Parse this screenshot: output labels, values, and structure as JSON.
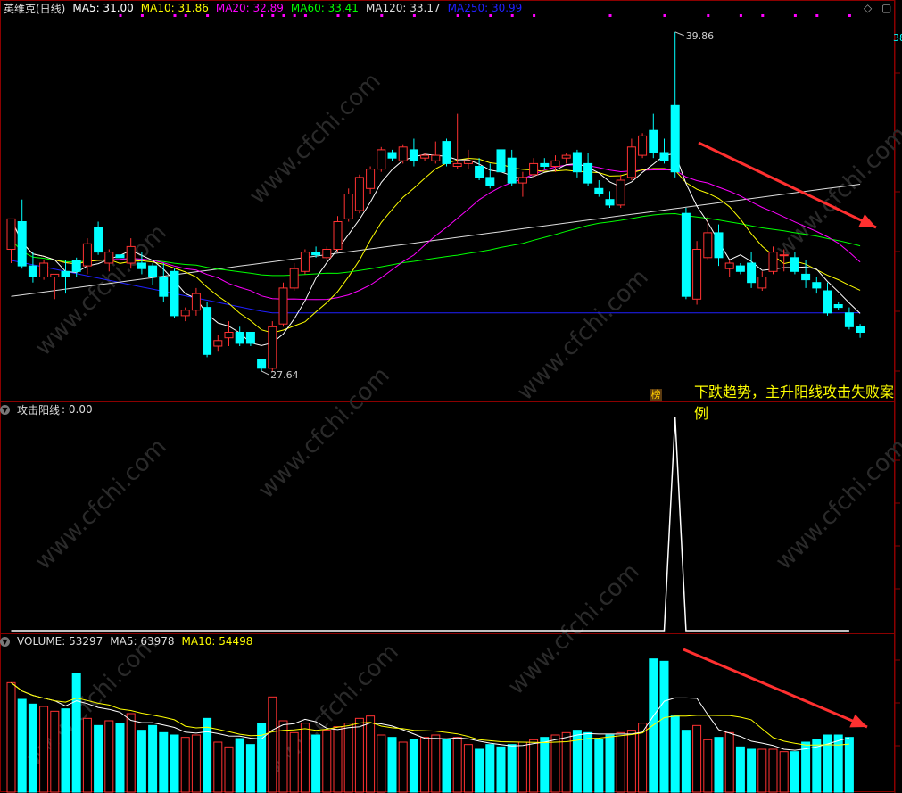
{
  "main": {
    "title": "英维克(日线)",
    "ma": [
      {
        "label": "MA5: 31.00",
        "color": "#ffffff"
      },
      {
        "label": "MA10: 31.86",
        "color": "#ffff00"
      },
      {
        "label": "MA20: 32.89",
        "color": "#ff00ff"
      },
      {
        "label": "MA60: 33.41",
        "color": "#00ff00"
      },
      {
        "label": "MA120: 33.17",
        "color": "#dddddd"
      },
      {
        "label": "MA250: 30.99",
        "color": "#2020ff"
      }
    ],
    "high_label": "39.86",
    "low_label": "27.64",
    "right_edge_label": "38",
    "badge": "榜"
  },
  "annotation": "下跌趋势，主升阳线攻击失败案例",
  "indicator": {
    "title": "攻击阳线",
    "value": ": 0.00"
  },
  "volume": {
    "label": "VOLUME: 53297",
    "ma5": "MA5: 63978",
    "ma10": "MA10: 54498"
  },
  "watermark": "www.cfchi.com",
  "colors": {
    "up": "#ff3232",
    "down": "#00ffff",
    "grid": "#8b0000",
    "ma5": "#ffffff",
    "ma10": "#ffff00",
    "ma20": "#ff00ff",
    "ma60": "#00ff00",
    "ma120": "#dddddd",
    "ma250": "#2020ff"
  },
  "chart_data": {
    "type": "candlestick",
    "candles": [
      {
        "o": 32.0,
        "h": 33.1,
        "c": 33.1,
        "l": 31.5
      },
      {
        "o": 33.0,
        "h": 33.8,
        "c": 31.4,
        "l": 31.3
      },
      {
        "o": 31.4,
        "h": 31.9,
        "c": 31.0,
        "l": 30.8
      },
      {
        "o": 31.0,
        "h": 31.6,
        "c": 31.5,
        "l": 30.9
      },
      {
        "o": 31.0,
        "h": 31.1,
        "c": 31.1,
        "l": 30.2
      },
      {
        "o": 31.2,
        "h": 31.6,
        "c": 31.0,
        "l": 30.4
      },
      {
        "o": 31.6,
        "h": 31.7,
        "c": 31.2,
        "l": 31.0
      },
      {
        "o": 31.4,
        "h": 32.4,
        "c": 32.2,
        "l": 31.1
      },
      {
        "o": 32.8,
        "h": 33.0,
        "c": 31.9,
        "l": 31.8
      },
      {
        "o": 31.5,
        "h": 32.0,
        "c": 31.9,
        "l": 31.2
      },
      {
        "o": 31.8,
        "h": 32.0,
        "c": 31.7,
        "l": 31.4
      },
      {
        "o": 31.5,
        "h": 32.4,
        "c": 32.1,
        "l": 31.3
      },
      {
        "o": 31.5,
        "h": 31.9,
        "c": 31.3,
        "l": 31.1
      },
      {
        "o": 31.4,
        "h": 31.5,
        "c": 31.0,
        "l": 30.7
      },
      {
        "o": 31.0,
        "h": 31.5,
        "c": 30.3,
        "l": 30.1
      },
      {
        "o": 31.2,
        "h": 31.3,
        "c": 29.6,
        "l": 29.5
      },
      {
        "o": 29.6,
        "h": 29.9,
        "c": 29.8,
        "l": 29.4
      },
      {
        "o": 29.8,
        "h": 30.6,
        "c": 30.4,
        "l": 29.6
      },
      {
        "o": 29.9,
        "h": 30.1,
        "c": 28.2,
        "l": 28.1
      },
      {
        "o": 28.5,
        "h": 28.9,
        "c": 28.7,
        "l": 28.3
      },
      {
        "o": 28.8,
        "h": 29.4,
        "c": 29.0,
        "l": 28.5
      },
      {
        "o": 29.0,
        "h": 29.2,
        "c": 28.6,
        "l": 28.5
      },
      {
        "o": 29.0,
        "h": 29.0,
        "c": 28.6,
        "l": 28.5
      },
      {
        "o": 28.0,
        "h": 28.0,
        "c": 27.7,
        "l": 27.6
      },
      {
        "o": 27.7,
        "h": 29.4,
        "c": 29.2,
        "l": 27.6
      },
      {
        "o": 29.3,
        "h": 30.8,
        "c": 30.6,
        "l": 29.2
      },
      {
        "o": 30.6,
        "h": 31.5,
        "c": 31.3,
        "l": 30.5
      },
      {
        "o": 31.2,
        "h": 32.0,
        "c": 31.9,
        "l": 31.1
      },
      {
        "o": 31.9,
        "h": 32.1,
        "c": 31.8,
        "l": 31.7
      },
      {
        "o": 31.7,
        "h": 32.1,
        "c": 32.0,
        "l": 31.6
      },
      {
        "o": 32.0,
        "h": 33.2,
        "c": 33.0,
        "l": 31.9
      },
      {
        "o": 33.1,
        "h": 34.2,
        "c": 34.0,
        "l": 33.0
      },
      {
        "o": 33.4,
        "h": 34.7,
        "c": 34.6,
        "l": 33.3
      },
      {
        "o": 34.2,
        "h": 35.0,
        "c": 34.9,
        "l": 34.0
      },
      {
        "o": 34.9,
        "h": 35.7,
        "c": 35.6,
        "l": 34.8
      },
      {
        "o": 35.5,
        "h": 35.6,
        "c": 35.3,
        "l": 35.2
      },
      {
        "o": 35.2,
        "h": 35.8,
        "c": 35.7,
        "l": 35.1
      },
      {
        "o": 35.6,
        "h": 36.0,
        "c": 35.2,
        "l": 35.0
      },
      {
        "o": 35.3,
        "h": 35.5,
        "c": 35.4,
        "l": 35.2
      },
      {
        "o": 35.2,
        "h": 35.9,
        "c": 35.4,
        "l": 35.1
      },
      {
        "o": 35.9,
        "h": 36.0,
        "c": 35.1,
        "l": 35.0
      },
      {
        "o": 35.0,
        "h": 36.9,
        "c": 35.1,
        "l": 34.9
      },
      {
        "o": 35.1,
        "h": 35.6,
        "c": 35.2,
        "l": 34.9
      },
      {
        "o": 35.0,
        "h": 35.3,
        "c": 34.6,
        "l": 34.5
      },
      {
        "o": 34.6,
        "h": 35.1,
        "c": 34.3,
        "l": 34.2
      },
      {
        "o": 35.6,
        "h": 35.8,
        "c": 34.8,
        "l": 34.6
      },
      {
        "o": 35.3,
        "h": 35.6,
        "c": 34.4,
        "l": 34.3
      },
      {
        "o": 34.4,
        "h": 34.8,
        "c": 34.6,
        "l": 33.9
      },
      {
        "o": 34.7,
        "h": 35.3,
        "c": 35.1,
        "l": 34.6
      },
      {
        "o": 35.1,
        "h": 35.3,
        "c": 35.0,
        "l": 34.9
      },
      {
        "o": 35.0,
        "h": 35.4,
        "c": 35.2,
        "l": 34.8
      },
      {
        "o": 35.3,
        "h": 35.5,
        "c": 35.4,
        "l": 35.1
      },
      {
        "o": 35.5,
        "h": 35.6,
        "c": 34.8,
        "l": 34.6
      },
      {
        "o": 35.1,
        "h": 35.5,
        "c": 34.4,
        "l": 34.3
      },
      {
        "o": 34.2,
        "h": 34.5,
        "c": 34.0,
        "l": 33.9
      },
      {
        "o": 33.8,
        "h": 34.1,
        "c": 33.6,
        "l": 33.5
      },
      {
        "o": 33.6,
        "h": 34.7,
        "c": 34.5,
        "l": 33.5
      },
      {
        "o": 34.6,
        "h": 36.0,
        "c": 35.7,
        "l": 34.5
      },
      {
        "o": 35.4,
        "h": 36.2,
        "c": 36.1,
        "l": 35.3
      },
      {
        "o": 36.3,
        "h": 36.9,
        "c": 35.5,
        "l": 35.3
      },
      {
        "o": 35.5,
        "h": 36.0,
        "c": 35.2,
        "l": 35.1
      },
      {
        "o": 37.2,
        "h": 39.86,
        "c": 34.8,
        "l": 34.6
      },
      {
        "o": 33.3,
        "h": 33.5,
        "c": 30.3,
        "l": 30.2
      },
      {
        "o": 30.2,
        "h": 32.3,
        "c": 32.0,
        "l": 30.0
      },
      {
        "o": 31.7,
        "h": 33.2,
        "c": 32.6,
        "l": 31.6
      },
      {
        "o": 32.6,
        "h": 32.9,
        "c": 31.7,
        "l": 31.4
      },
      {
        "o": 31.3,
        "h": 31.6,
        "c": 31.5,
        "l": 31.0
      },
      {
        "o": 31.4,
        "h": 31.5,
        "c": 31.2,
        "l": 31.1
      },
      {
        "o": 31.5,
        "h": 31.9,
        "c": 30.8,
        "l": 30.6
      },
      {
        "o": 30.6,
        "h": 31.2,
        "c": 31.0,
        "l": 30.5
      },
      {
        "o": 31.2,
        "h": 32.1,
        "c": 31.9,
        "l": 31.1
      },
      {
        "o": 31.8,
        "h": 32.0,
        "c": 31.8,
        "l": 31.2
      },
      {
        "o": 31.7,
        "h": 31.9,
        "c": 31.2,
        "l": 31.1
      },
      {
        "o": 31.1,
        "h": 31.6,
        "c": 30.9,
        "l": 30.6
      },
      {
        "o": 30.8,
        "h": 31.0,
        "c": 30.6,
        "l": 30.4
      },
      {
        "o": 30.5,
        "h": 30.8,
        "c": 29.7,
        "l": 29.6
      },
      {
        "o": 30.0,
        "h": 30.1,
        "c": 29.9,
        "l": 29.8
      },
      {
        "o": 29.7,
        "h": 29.9,
        "c": 29.2,
        "l": 29.1
      },
      {
        "o": 29.2,
        "h": 29.3,
        "c": 29.0,
        "l": 28.8
      }
    ],
    "volumes": [
      92,
      78,
      74,
      72,
      68,
      70,
      100,
      62,
      56,
      60,
      58,
      66,
      52,
      56,
      50,
      48,
      46,
      48,
      62,
      42,
      38,
      45,
      40,
      58,
      80,
      60,
      50,
      58,
      48,
      52,
      55,
      58,
      62,
      64,
      48,
      46,
      42,
      44,
      46,
      48,
      44,
      46,
      40,
      36,
      40,
      38,
      40,
      42,
      44,
      46,
      48,
      50,
      52,
      50,
      44,
      48,
      50,
      52,
      58,
      112,
      110,
      64,
      52,
      56,
      44,
      46,
      50,
      38,
      36,
      36,
      36,
      34,
      34,
      42,
      44,
      48,
      48,
      46
    ],
    "attack_indicator": [
      0,
      0,
      0,
      0,
      0,
      0,
      0,
      0,
      0,
      0,
      0,
      0,
      0,
      0,
      0,
      0,
      0,
      0,
      0,
      0,
      0,
      0,
      0,
      0,
      0,
      0,
      0,
      0,
      0,
      0,
      0,
      0,
      0,
      0,
      0,
      0,
      0,
      0,
      0,
      0,
      0,
      0,
      0,
      0,
      0,
      0,
      0,
      0,
      0,
      0,
      0,
      0,
      0,
      0,
      0,
      0,
      0,
      0,
      0,
      0,
      0,
      1,
      0,
      0,
      0,
      0,
      0,
      0,
      0,
      0,
      0,
      0,
      0,
      0,
      0,
      0,
      0,
      0
    ],
    "price_range": [
      26.5,
      40.5
    ],
    "volume_range": [
      0,
      120
    ]
  }
}
